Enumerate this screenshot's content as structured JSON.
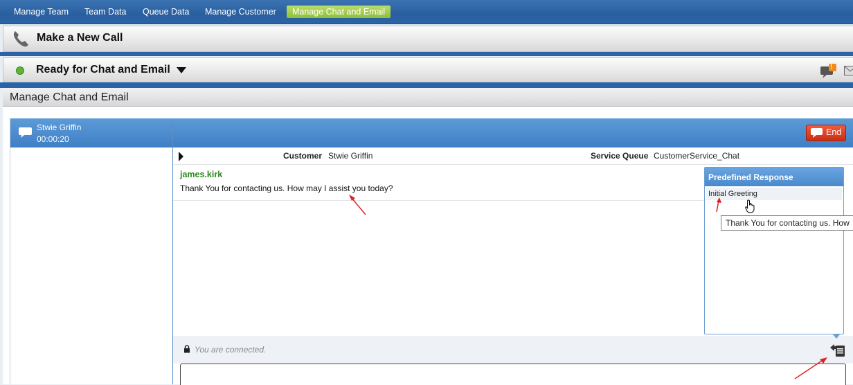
{
  "nav": {
    "tabs": [
      {
        "label": "Manage Team"
      },
      {
        "label": "Team Data"
      },
      {
        "label": "Queue Data"
      },
      {
        "label": "Manage Customer"
      },
      {
        "label": "Manage Chat and Email",
        "active": true
      }
    ]
  },
  "call_bar": {
    "title": "Make a New Call",
    "icon": "phone-icon"
  },
  "status_bar": {
    "title": "Ready for Chat and Email",
    "status_color": "#5fb336",
    "icons": [
      "chat-notification-icon",
      "email-icon"
    ],
    "badge": "!"
  },
  "section": {
    "title": "Manage Chat and Email"
  },
  "session": {
    "customer_name": "Stwie Griffin",
    "duration": "00:00:20"
  },
  "chat": {
    "end_label": "End",
    "customer_label": "Customer",
    "customer_value": "Stwie Griffin",
    "queue_label": "Service Queue",
    "queue_value": "CustomerService_Chat",
    "messages": [
      {
        "author": "james.kirk",
        "text": "Thank You for contacting us. How may I assist you today?"
      }
    ],
    "status_text": "You are connected."
  },
  "predefined": {
    "title": "Predefined Response",
    "items": [
      {
        "label": "Initial Greeting"
      }
    ],
    "tooltip": "Thank You for contacting us. How"
  },
  "colors": {
    "nav_bg": "#2b64a6",
    "active_tab": "#9cc844",
    "end_button": "#d9381e",
    "author": "#2e8b1e",
    "annotation_arrow": "#e02020"
  }
}
